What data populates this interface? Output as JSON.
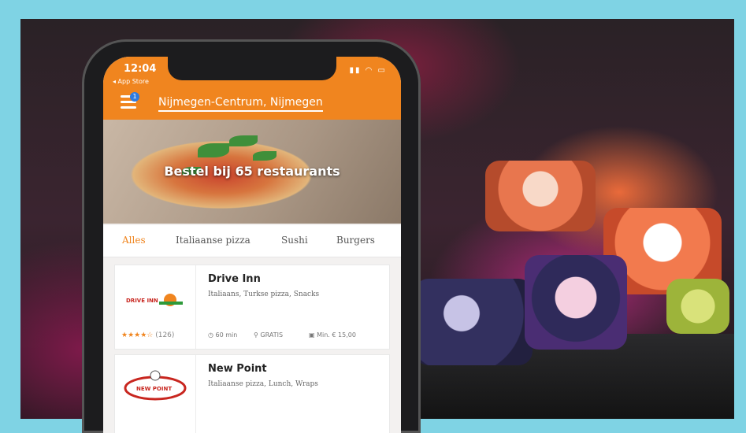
{
  "status": {
    "time": "12:04",
    "back_label": "◂ App Store"
  },
  "header": {
    "location": "Nijmegen-Centrum, Nijmegen",
    "badge": "1"
  },
  "hero": {
    "title": "Bestel bij 65 restaurants"
  },
  "tabs": [
    "Alles",
    "Italiaanse pizza",
    "Sushi",
    "Burgers"
  ],
  "restaurants": [
    {
      "name": "Drive Inn",
      "cuisines": "Italiaans, Turkse pizza, Snacks",
      "logo_text": "DRIVE INN",
      "rating_stars": "★★★★☆",
      "rating_count": "(126)",
      "delivery_time": "60 min",
      "delivery_cost": "GRATIS",
      "minimum": "Min. € 15,00"
    },
    {
      "name": "New Point",
      "cuisines": "Italiaanse pizza, Lunch, Wraps",
      "logo_text": "NEW POINT"
    }
  ],
  "colors": {
    "accent": "#f0851f",
    "frame": "#7fd3e4"
  }
}
